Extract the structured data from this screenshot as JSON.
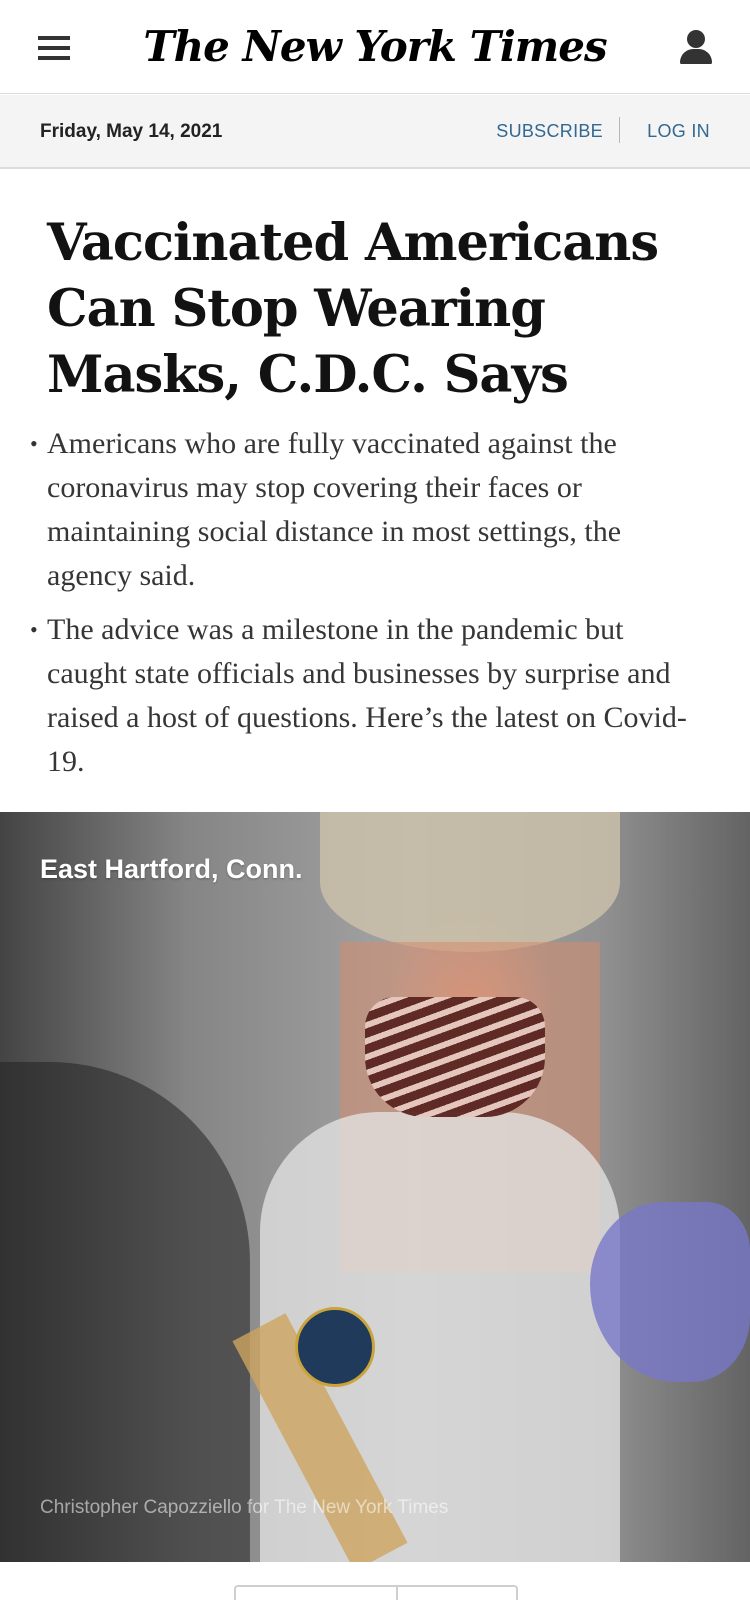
{
  "masthead": {
    "logo_text": "The New York Times",
    "menu_icon": "hamburger-menu-icon",
    "account_icon": "user-account-icon"
  },
  "datebar": {
    "date": "Friday, May 14, 2021",
    "subscribe_label": "SUBSCRIBE",
    "login_label": "LOG IN"
  },
  "article": {
    "headline": "Vaccinated Americans Can Stop Wearing Masks, C.D.C. Says",
    "summary": [
      "Americans who are fully vaccinated against the coronavirus may stop covering their faces or maintaining social distance in most settings, the agency said.",
      "The advice was a milestone in the pandemic but caught state officials and businesses by surprise and raised a host of questions. Here’s the latest on Covid-19."
    ],
    "photo": {
      "location": "East Hartford, Conn.",
      "credit": "Christopher Capozziello for The New York Times"
    }
  },
  "colors": {
    "link_blue": "#326891",
    "text_dark": "#121212",
    "datebar_bg": "#f4f4f4"
  }
}
